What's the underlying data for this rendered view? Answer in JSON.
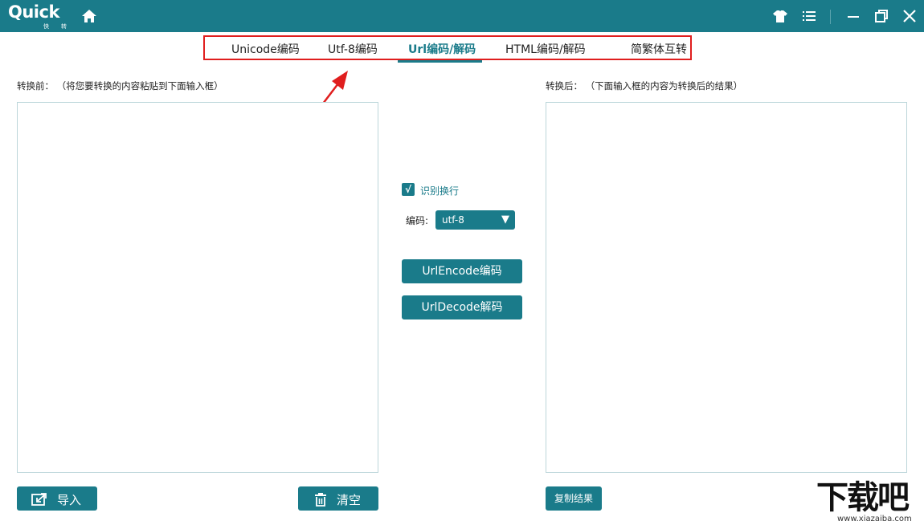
{
  "titlebar": {
    "logo_text": "Quick",
    "logo_sub": "快转",
    "colors": {
      "bar": "#1a7b8a",
      "accent_red": "#e01e1e"
    }
  },
  "tabs": [
    {
      "label": "Unicode编码",
      "active": false
    },
    {
      "label": "Utf-8编码",
      "active": false
    },
    {
      "label": "Url编码/解码",
      "active": true
    },
    {
      "label": "HTML编码/解码",
      "active": false
    },
    {
      "label": "简繁体互转",
      "active": false
    }
  ],
  "left": {
    "label": "转换前： （将您要转换的内容粘贴到下面输入框）",
    "input_value": "",
    "import_label": "导入",
    "clear_label": "清空"
  },
  "middle": {
    "recognize_newline_label": "识别换行",
    "recognize_newline_checked": true,
    "checkmark": "√",
    "encoding_label": "编码:",
    "encoding_value": "utf-8",
    "encode_button": "UrlEncode编码",
    "decode_button": "UrlDecode解码"
  },
  "right": {
    "label": "转换后： （下面输入框的内容为转换后的结果）",
    "output_value": "",
    "copy_label": "复制结果"
  },
  "watermark": {
    "big": "下载吧",
    "small": "www.xiazaiba.com"
  }
}
